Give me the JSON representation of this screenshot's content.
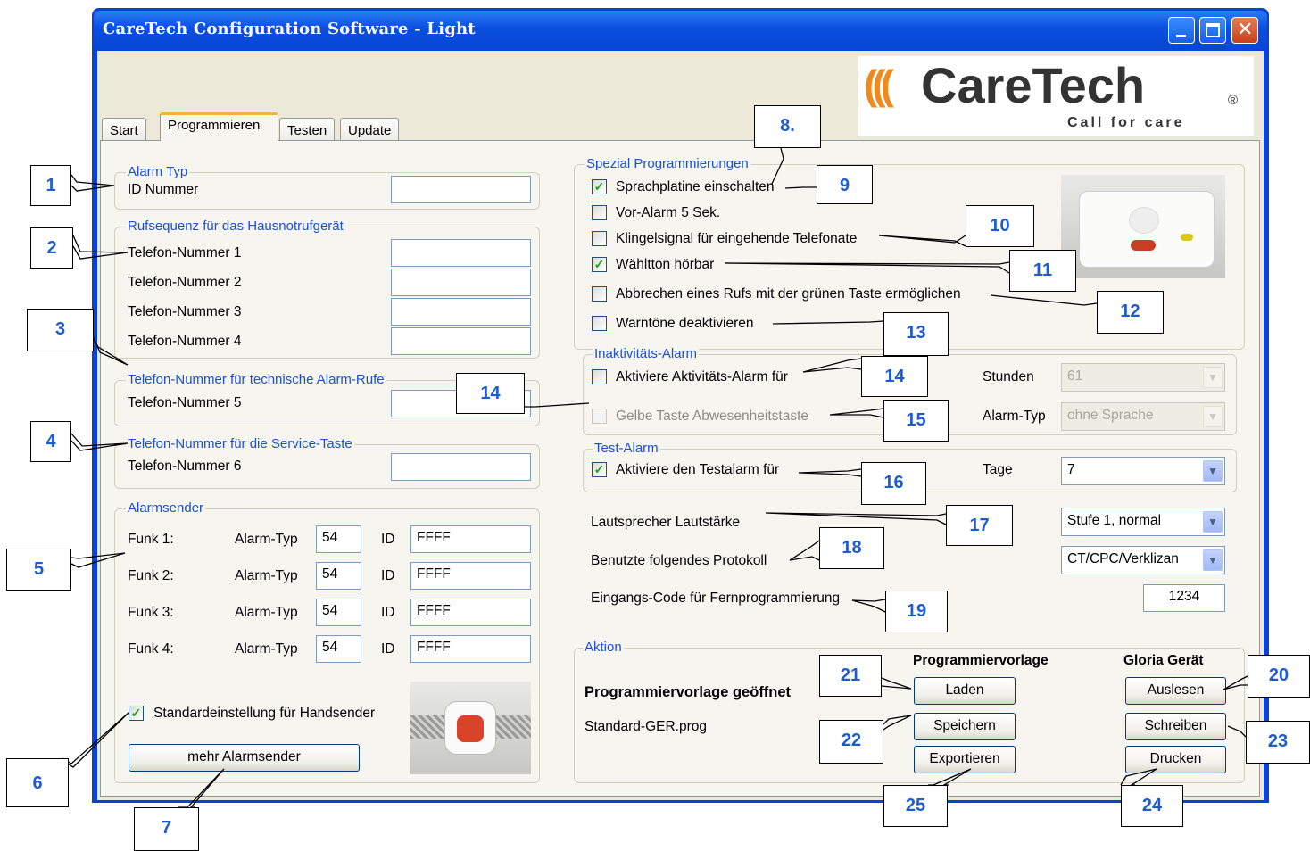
{
  "window": {
    "title": "CareTech Configuration Software - Light"
  },
  "logo": {
    "brand": "CareTech",
    "tagline": "Call for care",
    "reg": "®",
    "marks": "((("
  },
  "tabs": [
    {
      "label": "Start"
    },
    {
      "label": "Programmieren"
    },
    {
      "label": "Testen"
    },
    {
      "label": "Update"
    }
  ],
  "alarm_typ": {
    "legend": "Alarm Typ",
    "label": "ID Nummer",
    "value": ""
  },
  "rufsequenz": {
    "legend": "Rufsequenz für das Hausnotrufgerät",
    "rows": [
      {
        "label": "Telefon-Nummer 1",
        "value": ""
      },
      {
        "label": "Telefon-Nummer 2",
        "value": ""
      },
      {
        "label": "Telefon-Nummer 3",
        "value": ""
      },
      {
        "label": "Telefon-Nummer 4",
        "value": ""
      }
    ]
  },
  "technisch": {
    "legend": "Telefon-Nummer für technische Alarm-Rufe",
    "label": "Telefon-Nummer 5",
    "value": ""
  },
  "service": {
    "legend": "Telefon-Nummer für die Service-Taste",
    "label": "Telefon-Nummer 6",
    "value": ""
  },
  "alarmsender": {
    "legend": "Alarmsender",
    "typ_label": "Alarm-Typ",
    "id_label": "ID",
    "rows": [
      {
        "label": "Funk 1:",
        "typ": "54",
        "id": "FFFF"
      },
      {
        "label": "Funk 2:",
        "typ": "54",
        "id": "FFFF"
      },
      {
        "label": "Funk 3:",
        "typ": "54",
        "id": "FFFF"
      },
      {
        "label": "Funk 4:",
        "typ": "54",
        "id": "FFFF"
      }
    ],
    "standard_label": "Standardeinstellung für Handsender",
    "standard_checked": true,
    "more_button": "mehr Alarmsender"
  },
  "spezial": {
    "legend": "Spezial Programmierungen",
    "items": [
      {
        "label": "Sprachplatine einschalten",
        "checked": true
      },
      {
        "label": "Vor-Alarm 5 Sek.",
        "checked": false
      },
      {
        "label": "Klingelsignal für eingehende Telefonate",
        "checked": false
      },
      {
        "label": "Wähltton hörbar",
        "checked": true
      },
      {
        "label": "Abbrechen eines Rufs mit der grünen Taste ermöglichen",
        "checked": false
      },
      {
        "label": "Warntöne deaktivieren",
        "checked": false
      }
    ]
  },
  "inaktiv": {
    "legend": "Inaktivitäts-Alarm",
    "aktiv_label": "Aktiviere Aktivitäts-Alarm für",
    "gelbe_label": "Gelbe Taste Abwesenheitstaste",
    "stunden_label": "Stunden",
    "stunden_value": "61",
    "alarmtyp_label": "Alarm-Typ",
    "alarmtyp_value": "ohne Sprache"
  },
  "testalarm": {
    "legend": "Test-Alarm",
    "label": "Aktiviere den Testalarm für",
    "checked": true,
    "tage_label": "Tage",
    "tage_value": "7"
  },
  "lautsprecher": {
    "label": "Lautsprecher Lautstärke",
    "value": "Stufe 1, normal"
  },
  "protokoll": {
    "label": "Benutzte folgendes Protokoll",
    "value": "CT/CPC/Verklizan"
  },
  "code": {
    "label": "Eingangs-Code für Fernprogrammierung",
    "value": "1234"
  },
  "aktion": {
    "legend": "Aktion",
    "col1_header": "Programmiervorlage",
    "col2_header": "Gloria Gerät",
    "open_label": "Programmiervorlage geöffnet",
    "file": "Standard-GER.prog",
    "laden": "Laden",
    "speichern": "Speichern",
    "exportieren": "Exportieren",
    "auslesen": "Auslesen",
    "schreiben": "Schreiben",
    "drucken": "Drucken"
  },
  "callouts": [
    "1",
    "2",
    "3",
    "4",
    "5",
    "6",
    "7",
    "8.",
    "9",
    "10",
    "11",
    "12",
    "13",
    "14",
    "14",
    "15",
    "16",
    "17",
    "18",
    "19",
    "20",
    "21",
    "22",
    "23",
    "24",
    "25"
  ],
  "colors": {
    "title_bar": "#0a4fe0",
    "legend_text": "#1c4fd8",
    "callout_text": "#1e5cd4",
    "logo_orange": "#f08a1c"
  }
}
